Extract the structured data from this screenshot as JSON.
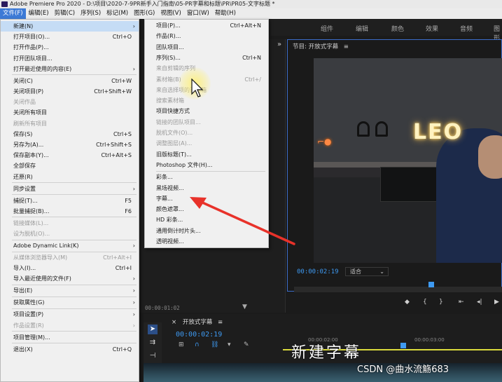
{
  "window": {
    "title": "Adobe Premiere Pro 2020 - D:\\项目\\2020-7-9PR新手入门指南\\05-PR字幕和标题\\PR\\PR05-文字标题 *"
  },
  "menubar": [
    "文件(F)",
    "编辑(E)",
    "剪辑(C)",
    "序列(S)",
    "标记(M)",
    "图形(G)",
    "视图(V)",
    "窗口(W)",
    "帮助(H)"
  ],
  "workspace_tabs": [
    "组件",
    "编辑",
    "颜色",
    "效果",
    "音频",
    "图形"
  ],
  "program_panel": {
    "title": "节目: 开放式字幕",
    "menu_glyph": "≡",
    "timecode": "00:00:02:19",
    "fit": "适合",
    "video_neon": "LEO"
  },
  "source_panel": {
    "timecode": "00:00:01:02",
    "expand_glyph": "»"
  },
  "timeline": {
    "close_glyph": "×",
    "title": "开放式字幕",
    "menu_glyph": "≡",
    "timecode": "00:00:02:19",
    "ruler_labels": [
      "00:00:02:00",
      "00:00:03:00"
    ],
    "caption_overlay": "新建字幕"
  },
  "watermark": "CSDN @曲水流觞683",
  "file_menu": [
    {
      "label": "新建(N)",
      "shortcut": "",
      "submenu": true,
      "disabled": false,
      "highlight": true
    },
    {
      "label": "打开项目(O)...",
      "shortcut": "Ctrl+O",
      "submenu": false,
      "disabled": false
    },
    {
      "label": "打开作品(P)...",
      "shortcut": "",
      "submenu": false,
      "disabled": false
    },
    {
      "label": "打开团队项目...",
      "shortcut": "",
      "submenu": false,
      "disabled": false
    },
    {
      "label": "打开最近使用的内容(E)",
      "shortcut": "",
      "submenu": true,
      "disabled": false
    },
    {
      "sep": true
    },
    {
      "label": "关闭(C)",
      "shortcut": "Ctrl+W",
      "submenu": false,
      "disabled": false
    },
    {
      "label": "关闭项目(P)",
      "shortcut": "Ctrl+Shift+W",
      "submenu": false,
      "disabled": false
    },
    {
      "label": "关闭作品",
      "shortcut": "",
      "submenu": false,
      "disabled": true
    },
    {
      "label": "关闭所有项目",
      "shortcut": "",
      "submenu": false,
      "disabled": false
    },
    {
      "label": "刷新所有项目",
      "shortcut": "",
      "submenu": false,
      "disabled": true
    },
    {
      "label": "保存(S)",
      "shortcut": "Ctrl+S",
      "submenu": false,
      "disabled": false
    },
    {
      "label": "另存为(A)...",
      "shortcut": "Ctrl+Shift+S",
      "submenu": false,
      "disabled": false
    },
    {
      "label": "保存副本(Y)...",
      "shortcut": "Ctrl+Alt+S",
      "submenu": false,
      "disabled": false
    },
    {
      "label": "全部保存",
      "shortcut": "",
      "submenu": false,
      "disabled": false
    },
    {
      "label": "还原(R)",
      "shortcut": "",
      "submenu": false,
      "disabled": false
    },
    {
      "sep": true
    },
    {
      "label": "同步设置",
      "shortcut": "",
      "submenu": true,
      "disabled": false
    },
    {
      "sep": true
    },
    {
      "label": "捕捉(T)...",
      "shortcut": "F5",
      "submenu": false,
      "disabled": false
    },
    {
      "label": "批量捕捉(B)...",
      "shortcut": "F6",
      "submenu": false,
      "disabled": false
    },
    {
      "sep": true
    },
    {
      "label": "链接媒体(L)...",
      "shortcut": "",
      "submenu": false,
      "disabled": true
    },
    {
      "label": "设为脱机(O)...",
      "shortcut": "",
      "submenu": false,
      "disabled": true
    },
    {
      "sep": true
    },
    {
      "label": "Adobe Dynamic Link(K)",
      "shortcut": "",
      "submenu": true,
      "disabled": false
    },
    {
      "sep": true
    },
    {
      "label": "从媒体浏览器导入(M)",
      "shortcut": "Ctrl+Alt+I",
      "submenu": false,
      "disabled": true
    },
    {
      "label": "导入(I)...",
      "shortcut": "Ctrl+I",
      "submenu": false,
      "disabled": false
    },
    {
      "label": "导入最近使用的文件(F)",
      "shortcut": "",
      "submenu": true,
      "disabled": false
    },
    {
      "sep": true
    },
    {
      "label": "导出(E)",
      "shortcut": "",
      "submenu": true,
      "disabled": false
    },
    {
      "sep": true
    },
    {
      "label": "获取属性(G)",
      "shortcut": "",
      "submenu": true,
      "disabled": false
    },
    {
      "sep": true
    },
    {
      "label": "项目设置(P)",
      "shortcut": "",
      "submenu": true,
      "disabled": false
    },
    {
      "label": "作品设置(R)",
      "shortcut": "",
      "submenu": true,
      "disabled": true
    },
    {
      "sep": true
    },
    {
      "label": "项目管理(M)...",
      "shortcut": "",
      "submenu": false,
      "disabled": false
    },
    {
      "sep": true
    },
    {
      "label": "退出(X)",
      "shortcut": "Ctrl+Q",
      "submenu": false,
      "disabled": false
    }
  ],
  "new_menu": [
    {
      "label": "项目(P)...",
      "shortcut": "Ctrl+Alt+N",
      "disabled": false
    },
    {
      "label": "作品(R)...",
      "shortcut": "",
      "disabled": false
    },
    {
      "label": "团队项目...",
      "shortcut": "",
      "disabled": false
    },
    {
      "label": "序列(S)...",
      "shortcut": "Ctrl+N",
      "disabled": false
    },
    {
      "label": "来自剪辑的序列",
      "shortcut": "",
      "disabled": true
    },
    {
      "label": "素材箱(B)",
      "shortcut": "Ctrl+/",
      "disabled": true
    },
    {
      "label": "来自选择项的素材箱",
      "shortcut": "",
      "disabled": true
    },
    {
      "label": "搜索素材箱",
      "shortcut": "",
      "disabled": true
    },
    {
      "label": "项目快捷方式",
      "shortcut": "",
      "disabled": false
    },
    {
      "label": "链接的团队项目...",
      "shortcut": "",
      "disabled": true
    },
    {
      "label": "脱机文件(O)...",
      "shortcut": "",
      "disabled": true
    },
    {
      "label": "调整图层(A)...",
      "shortcut": "",
      "disabled": true
    },
    {
      "label": "旧版标题(T)...",
      "shortcut": "",
      "disabled": false
    },
    {
      "label": "Photoshop 文件(H)...",
      "shortcut": "",
      "disabled": false
    },
    {
      "sep": true
    },
    {
      "label": "彩条...",
      "shortcut": "",
      "disabled": false
    },
    {
      "label": "黑场视频...",
      "shortcut": "",
      "disabled": false
    },
    {
      "label": "字幕...",
      "shortcut": "",
      "disabled": false
    },
    {
      "label": "颜色遮罩...",
      "shortcut": "",
      "disabled": false
    },
    {
      "label": "HD 彩条...",
      "shortcut": "",
      "disabled": false
    },
    {
      "label": "通用倒计时片头...",
      "shortcut": "",
      "disabled": false
    },
    {
      "label": "透明视频...",
      "shortcut": "",
      "disabled": false
    }
  ],
  "annotation_color": "#e8322a",
  "accent_color": "#3e9af2"
}
